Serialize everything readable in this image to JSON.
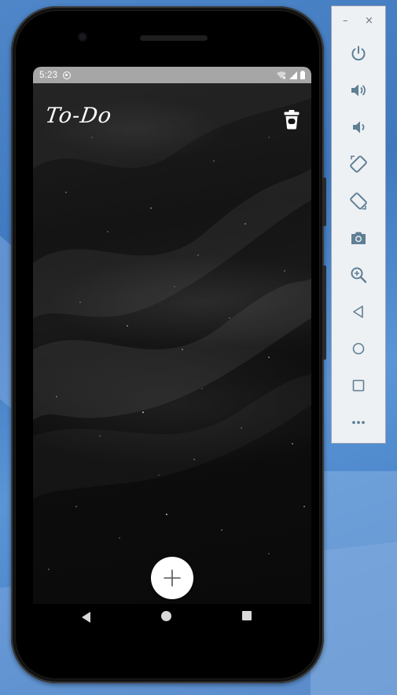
{
  "status_bar": {
    "time": "5:23"
  },
  "app": {
    "title": "To-Do"
  },
  "icons": {
    "trash": "trash-icon",
    "add": "plus-icon"
  },
  "toolbar": {
    "minimize_label": "–",
    "close_label": "×",
    "buttons": [
      "power-icon",
      "volume-up-icon",
      "volume-down-icon",
      "rotate-left-icon",
      "rotate-right-icon",
      "camera-icon",
      "zoom-icon",
      "back-icon",
      "home-icon",
      "overview-icon",
      "more-icon"
    ]
  },
  "colors": {
    "status_bar": "#a6a6a6",
    "toolbar_icon": "#5f7f95",
    "fab": "#ffffff"
  }
}
